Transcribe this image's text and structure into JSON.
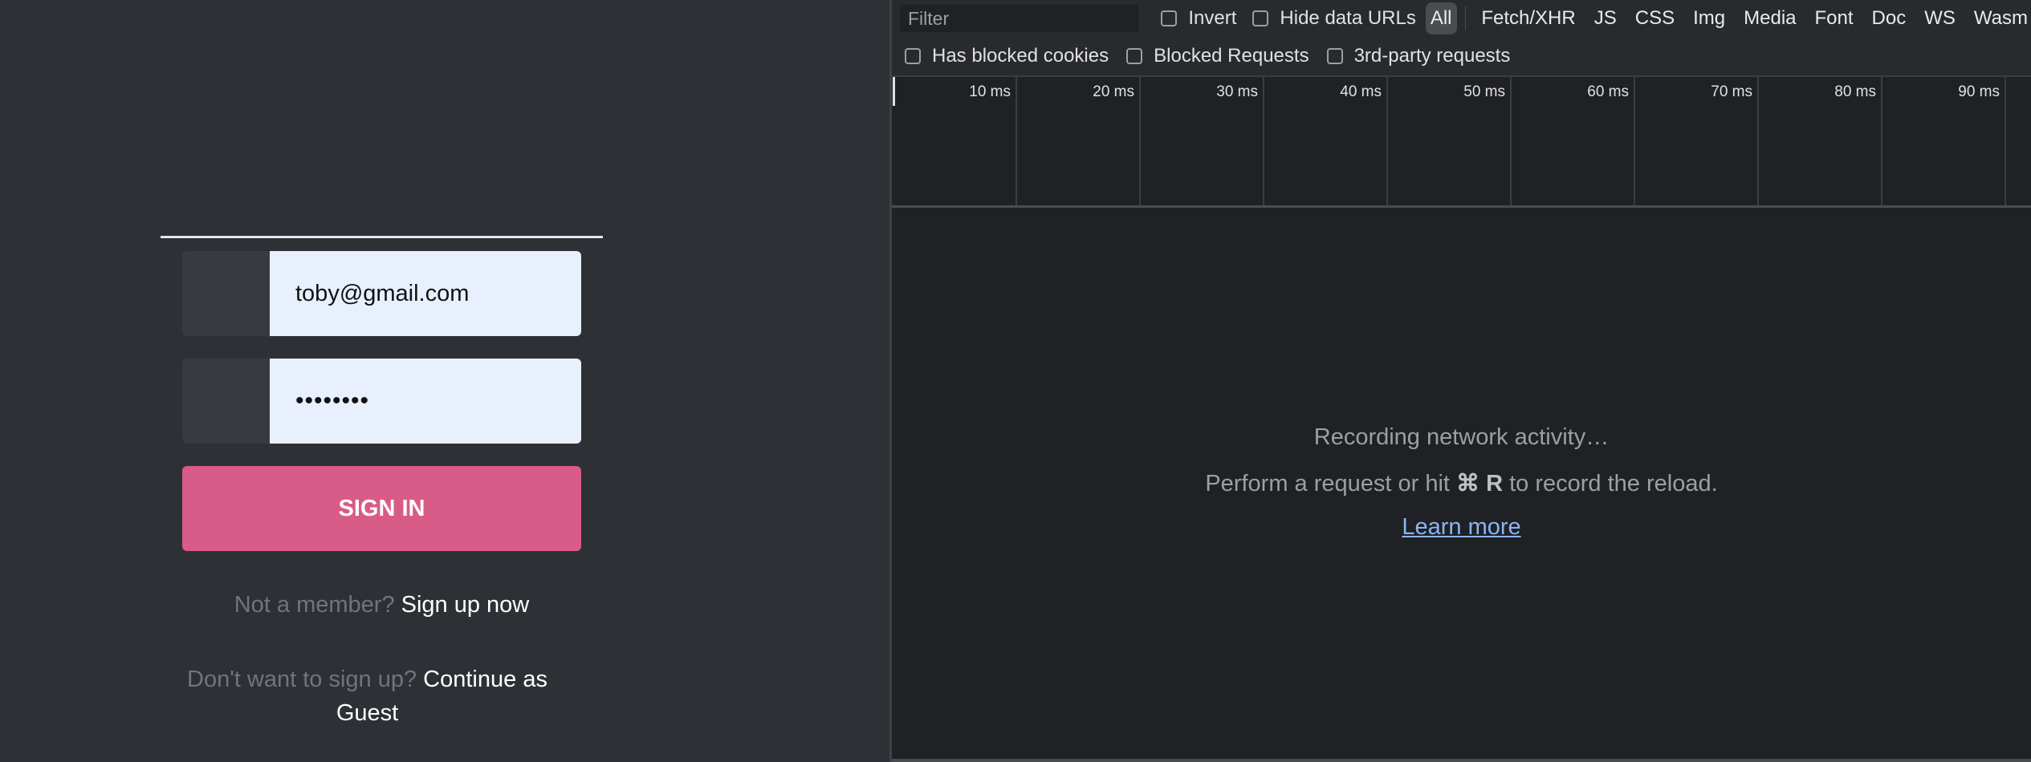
{
  "login": {
    "email_value": "toby@gmail.com",
    "password_mask": "••••••••",
    "sign_in_label": "SIGN IN",
    "member_prompt": "Not a member?",
    "signup_link": "Sign up now",
    "guest_prompt": "Don't want to sign up?",
    "guest_link": "Continue as Guest",
    "accent_color": "#d95b88"
  },
  "devtools": {
    "filter_placeholder": "Filter",
    "invert_label": "Invert",
    "hide_data_urls_label": "Hide data URLs",
    "types": [
      "All",
      "Fetch/XHR",
      "JS",
      "CSS",
      "Img",
      "Media",
      "Font",
      "Doc",
      "WS",
      "Wasm"
    ],
    "active_type": "All",
    "has_blocked_cookies_label": "Has blocked cookies",
    "blocked_requests_label": "Blocked Requests",
    "third_party_label": "3rd-party requests",
    "timeline_ticks": [
      "10 ms",
      "20 ms",
      "30 ms",
      "40 ms",
      "50 ms",
      "60 ms",
      "70 ms",
      "80 ms",
      "90 ms"
    ],
    "empty_title": "Recording network activity…",
    "empty_sub_prefix": "Perform a request or hit",
    "empty_sub_key": "⌘ R",
    "empty_sub_suffix": "to record the reload.",
    "learn_more": "Learn more"
  }
}
